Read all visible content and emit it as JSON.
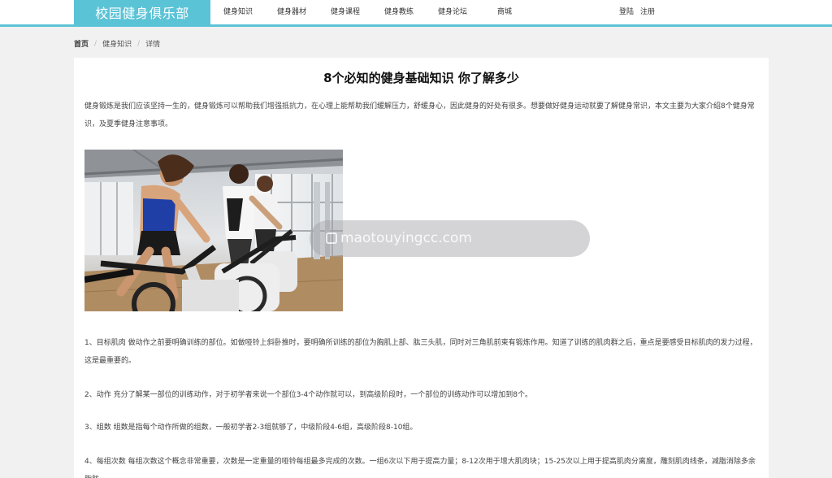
{
  "brand": "校园健身俱乐部",
  "nav": [
    {
      "label": "健身知识",
      "w": 0
    },
    {
      "label": "健身器材"
    },
    {
      "label": "健身课程"
    },
    {
      "label": "健身教练"
    },
    {
      "label": "健身论坛"
    },
    {
      "label": "商城"
    }
  ],
  "auth": {
    "login": "登陆",
    "register": "注册"
  },
  "breadcrumb": {
    "home": "首页",
    "section": "健身知识",
    "current": "详情",
    "sep": "/"
  },
  "article": {
    "title": "8个必知的健身基础知识 你了解多少",
    "intro": "健身锻炼是我们应该坚持一生的，健身锻炼可以帮助我们增强抵抗力，在心理上能帮助我们缓解压力，舒缓身心，因此健身的好处有很多。想要做好健身运动就要了解健身常识，本文主要为大家介绍8个健身常识，及夏季健身注意事项。",
    "points": [
      "1、目标肌肉 做动作之前要明确训练的部位。如做哑铃上斜卧推时，要明确所训练的部位为胸肌上部、肱三头肌，同时对三角肌前束有锻炼作用。知道了训练的肌肉群之后，重点是要感受目标肌肉的发力过程，这是最重要的。",
      "2、动作 充分了解某一部位的训练动作，对于初学者来说一个部位3-4个动作就可以，到高级阶段时，一个部位的训练动作可以增加到8个。",
      "3、组数 组数是指每个动作所做的组数，一般初学者2-3组就够了，中级阶段4-6组，高级阶段8-10组。",
      "4、每组次数 每组次数这个概念非常重要，次数是一定重量的哑铃每组最多完成的次数。一组6次以下用于提高力量；8-12次用于增大肌肉块；15-25次以上用于提高肌肉分离度，雕刻肌肉线条，减脂消除多余脂肪。"
    ]
  },
  "watermark": "maotouyingcc.com"
}
